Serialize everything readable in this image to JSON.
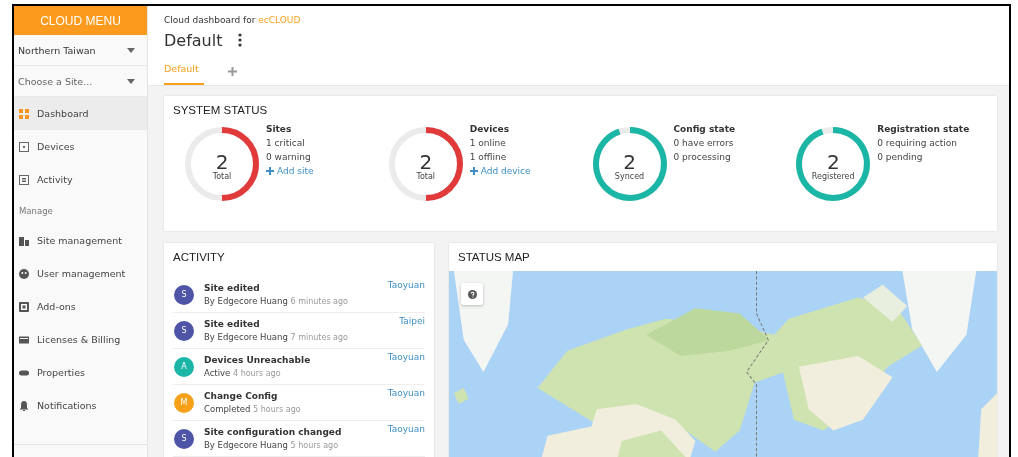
{
  "sidebar": {
    "title": "CLOUD MENU",
    "selectors": [
      {
        "value": "Northern Taiwan"
      },
      {
        "placeholder": "Choose a Site..."
      }
    ],
    "items": [
      {
        "label": "Dashboard",
        "selected": true
      },
      {
        "label": "Devices",
        "selected": false
      },
      {
        "label": "Activity",
        "selected": false
      }
    ],
    "section": "Manage",
    "manage_items": [
      {
        "label": "Site management",
        "selected": false
      },
      {
        "label": "User management",
        "selected": false
      },
      {
        "label": "Add-ons",
        "selected": false
      },
      {
        "label": "Licenses & Billing",
        "selected": false
      },
      {
        "label": "Properties",
        "selected": false
      },
      {
        "label": "Notifications",
        "selected": false
      }
    ]
  },
  "header": {
    "breadcrumb": "Cloud dashboard for",
    "org": "ecCLOUD",
    "title": "Default",
    "tabs": [
      {
        "label": "Default",
        "selected": true
      }
    ]
  },
  "system_status": {
    "title": "SYSTEM STATUS",
    "stats": [
      {
        "value": "2",
        "caption": "Total",
        "color": "#e03a3a",
        "level": 0.5,
        "title": "Sites",
        "lines": [
          "1 critical",
          "0 warning"
        ],
        "link": "Add site"
      },
      {
        "value": "2",
        "caption": "Total",
        "color": "#e03a3a",
        "level": 0.5,
        "title": "Devices",
        "lines": [
          "1 online",
          "1 offline"
        ],
        "link": "Add device"
      },
      {
        "value": "2",
        "caption": "Synced",
        "color": "#1cb6a6",
        "level": 0.95,
        "title": "Config state",
        "lines": [
          "0 have errors",
          "0 processing"
        ]
      },
      {
        "value": "2",
        "caption": "Registered",
        "color": "#1cb6a6",
        "level": 0.95,
        "title": "Registration state",
        "lines": [
          "0 requiring action",
          "0 pending"
        ]
      }
    ]
  },
  "activity": {
    "title": "ACTIVITY",
    "items": [
      {
        "avatar": "S",
        "color": "#4f55a6",
        "title": "Site edited",
        "actor": "By Edgecore Huang",
        "time": "6 minutes ago",
        "location": "Taoyuan"
      },
      {
        "avatar": "S",
        "color": "#4f55a6",
        "title": "Site edited",
        "actor": "By Edgecore Huang",
        "time": "7 minutes ago",
        "location": "Taipei"
      },
      {
        "avatar": "A",
        "color": "#1cb6a6",
        "title": "Devices Unreachable",
        "actor": "Active",
        "time": "4 hours ago",
        "location": "Taoyuan"
      },
      {
        "avatar": "M",
        "color": "#f7a11a",
        "title": "Change Config",
        "actor": "Completed",
        "time": "5 hours ago",
        "location": "Taoyuan"
      },
      {
        "avatar": "S",
        "color": "#4f55a6",
        "title": "Site configuration changed",
        "actor": "By Edgecore Huang",
        "time": "5 hours ago",
        "location": "Taoyuan"
      }
    ]
  },
  "status_map": {
    "title": "STATUS MAP"
  }
}
